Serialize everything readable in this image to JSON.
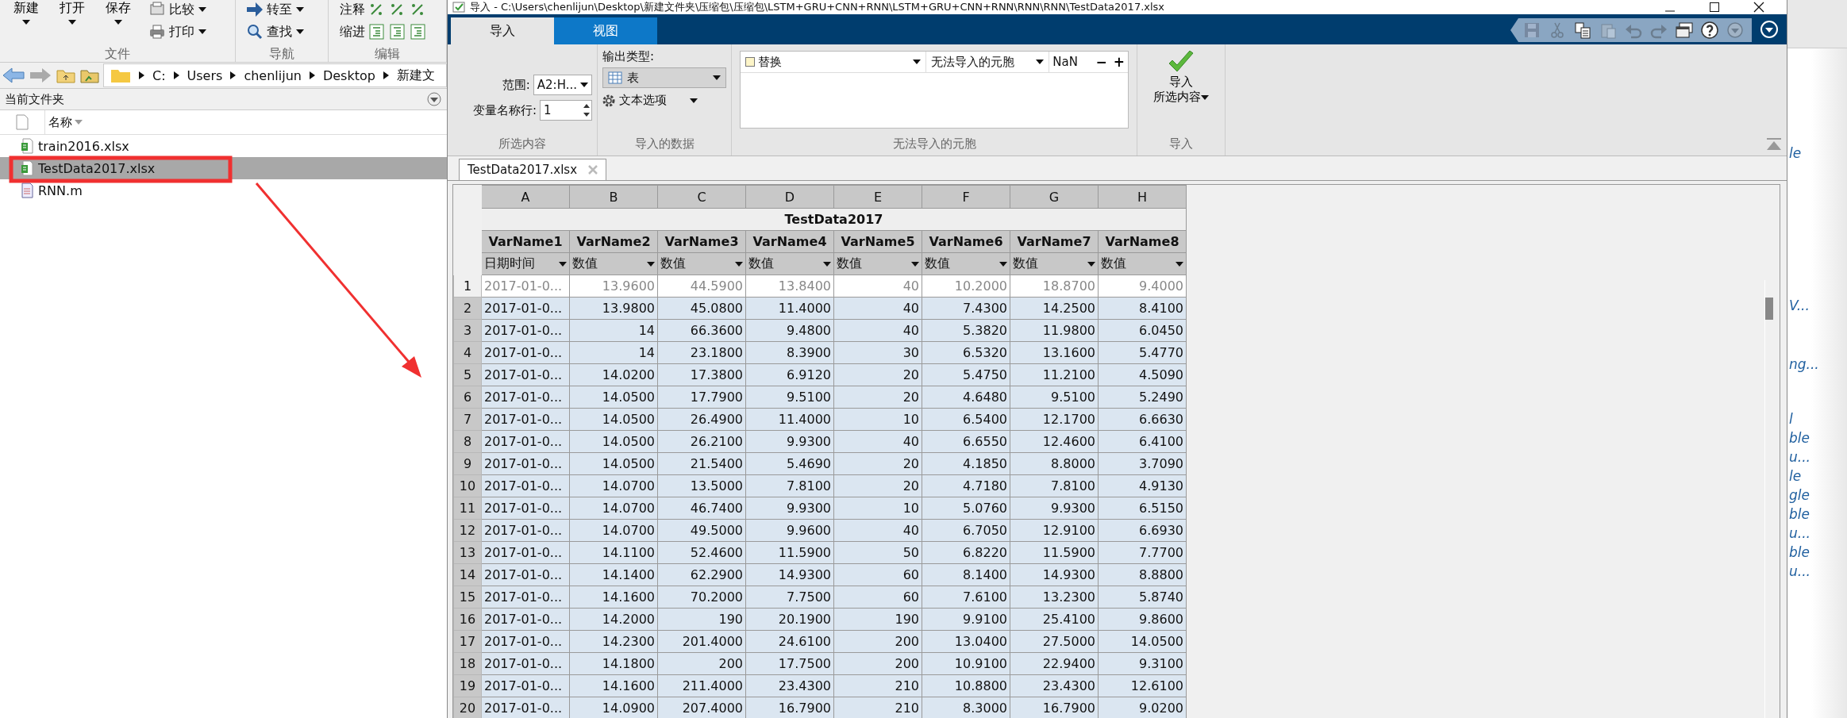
{
  "main_toolstrip": {
    "sections": [
      {
        "label": "文件",
        "big_buttons": [
          "新建",
          "打开",
          "保存"
        ],
        "small_buttons": [
          {
            "label": "比较",
            "kind": "compare"
          },
          {
            "label": "打印",
            "kind": "print"
          }
        ]
      },
      {
        "label": "导航",
        "small_buttons": [
          {
            "label": "转至",
            "kind": "goto"
          },
          {
            "label": "查找",
            "kind": "find"
          }
        ]
      },
      {
        "label": "编辑",
        "small_buttons": [
          {
            "label": "注释",
            "kind": "comment"
          },
          {
            "label": "缩进",
            "kind": "indent"
          }
        ]
      }
    ]
  },
  "address_bar": {
    "segments": [
      "C:",
      "Users",
      "chenlijun",
      "Desktop",
      "新建文"
    ]
  },
  "current_folder": {
    "title": "当前文件夹",
    "column": "名称",
    "files": [
      {
        "name": "train2016.xlsx",
        "kind": "xlsx",
        "selected": false
      },
      {
        "name": "TestData2017.xlsx",
        "kind": "xlsx",
        "selected": true
      },
      {
        "name": "RNN.m",
        "kind": "m",
        "selected": false
      }
    ]
  },
  "import_window": {
    "title": "导入 - C:\\Users\\chenlijun\\Desktop\\新建文件夹\\压缩包\\压缩包\\LSTM+GRU+CNN+RNN\\LSTM+GRU+CNN+RNN\\RNN\\RNN\\TestData2017.xlsx",
    "tabs": [
      {
        "label": "导入",
        "selected": true
      },
      {
        "label": "视图",
        "selected": false
      }
    ],
    "quick_access": [
      {
        "kind": "save",
        "disabled": true
      },
      {
        "kind": "cut",
        "disabled": true
      },
      {
        "kind": "copy",
        "disabled": false
      },
      {
        "kind": "paste",
        "disabled": true
      },
      {
        "kind": "undo",
        "disabled": true
      },
      {
        "kind": "redo",
        "disabled": true
      },
      {
        "kind": "windows",
        "disabled": false
      },
      {
        "kind": "help",
        "disabled": false
      },
      {
        "kind": "menu",
        "disabled": true
      }
    ],
    "selection": {
      "label": "所选内容",
      "range_label": "范围:",
      "range": "A2:H...",
      "names_row_label": "变量名称行:",
      "names_row": "1"
    },
    "imported_data": {
      "label": "导入的数据",
      "output_type_label": "输出类型:",
      "output_type": "表",
      "text_options": "文本选项"
    },
    "unimportable": {
      "label": "无法导入的元胞",
      "rules": [
        {
          "action": "替换",
          "target": "无法导入的元胞",
          "value": "NaN"
        }
      ],
      "buttons": [
        "−",
        "+"
      ]
    },
    "import": {
      "label": "导入",
      "button_lines": [
        "导入",
        "所选内容"
      ]
    },
    "document_tab": "TestData2017.xlsx",
    "table": {
      "title": "TestData2017",
      "columns": [
        {
          "letter": "A",
          "name": "VarName1",
          "type": "日期时间"
        },
        {
          "letter": "B",
          "name": "VarName2",
          "type": "数值"
        },
        {
          "letter": "C",
          "name": "VarName3",
          "type": "数值"
        },
        {
          "letter": "D",
          "name": "VarName4",
          "type": "数值"
        },
        {
          "letter": "E",
          "name": "VarName5",
          "type": "数值"
        },
        {
          "letter": "F",
          "name": "VarName6",
          "type": "数值"
        },
        {
          "letter": "G",
          "name": "VarName7",
          "type": "数值"
        },
        {
          "letter": "H",
          "name": "VarName8",
          "type": "数值"
        }
      ],
      "rows": [
        {
          "number": "1",
          "selected": false,
          "cells": [
            "2017-01-0...",
            "13.9600",
            "44.5900",
            "13.8400",
            "40",
            "10.2000",
            "18.8700",
            "9.4000"
          ]
        },
        {
          "number": "2",
          "selected": true,
          "cells": [
            "2017-01-0...",
            "13.9800",
            "45.0800",
            "11.4000",
            "40",
            "7.4300",
            "14.2500",
            "8.4100"
          ]
        },
        {
          "number": "3",
          "selected": true,
          "cells": [
            "2017-01-0...",
            "14",
            "66.3600",
            "9.4800",
            "40",
            "5.3820",
            "11.9800",
            "6.0450"
          ]
        },
        {
          "number": "4",
          "selected": true,
          "cells": [
            "2017-01-0...",
            "14",
            "23.1800",
            "8.3900",
            "30",
            "6.5320",
            "13.1600",
            "5.4770"
          ]
        },
        {
          "number": "5",
          "selected": true,
          "cells": [
            "2017-01-0...",
            "14.0200",
            "17.3800",
            "6.9120",
            "20",
            "5.4750",
            "11.2100",
            "4.5090"
          ]
        },
        {
          "number": "6",
          "selected": true,
          "cells": [
            "2017-01-0...",
            "14.0500",
            "17.7900",
            "9.5100",
            "20",
            "4.6480",
            "9.5100",
            "5.2490"
          ]
        },
        {
          "number": "7",
          "selected": true,
          "cells": [
            "2017-01-0...",
            "14.0500",
            "26.4900",
            "11.4000",
            "10",
            "6.5400",
            "12.1700",
            "6.6630"
          ]
        },
        {
          "number": "8",
          "selected": true,
          "cells": [
            "2017-01-0...",
            "14.0500",
            "26.2100",
            "9.9300",
            "40",
            "6.6550",
            "12.4600",
            "6.4100"
          ]
        },
        {
          "number": "9",
          "selected": true,
          "cells": [
            "2017-01-0...",
            "14.0500",
            "21.5400",
            "5.4690",
            "20",
            "4.1850",
            "8.8000",
            "3.7090"
          ]
        },
        {
          "number": "10",
          "selected": true,
          "cells": [
            "2017-01-0...",
            "14.0700",
            "13.5000",
            "7.8100",
            "20",
            "4.7180",
            "7.8100",
            "4.9130"
          ]
        },
        {
          "number": "11",
          "selected": true,
          "cells": [
            "2017-01-0...",
            "14.0700",
            "46.7400",
            "9.9300",
            "10",
            "5.0760",
            "9.9300",
            "6.5150"
          ]
        },
        {
          "number": "12",
          "selected": true,
          "cells": [
            "2017-01-0...",
            "14.0700",
            "49.5000",
            "9.9600",
            "40",
            "6.7050",
            "12.9100",
            "6.6930"
          ]
        },
        {
          "number": "13",
          "selected": true,
          "cells": [
            "2017-01-0...",
            "14.1100",
            "52.4600",
            "11.5900",
            "50",
            "6.8220",
            "11.5900",
            "7.7700"
          ]
        },
        {
          "number": "14",
          "selected": true,
          "cells": [
            "2017-01-0...",
            "14.1400",
            "62.2900",
            "14.9300",
            "60",
            "8.1400",
            "14.9300",
            "8.8800"
          ]
        },
        {
          "number": "15",
          "selected": true,
          "cells": [
            "2017-01-0...",
            "14.1600",
            "70.2000",
            "7.7500",
            "60",
            "7.6100",
            "13.2300",
            "5.8740"
          ]
        },
        {
          "number": "16",
          "selected": true,
          "cells": [
            "2017-01-0...",
            "14.2000",
            "190",
            "20.1900",
            "190",
            "9.9100",
            "25.4100",
            "9.8600"
          ]
        },
        {
          "number": "17",
          "selected": true,
          "cells": [
            "2017-01-0...",
            "14.2300",
            "201.4000",
            "24.6100",
            "200",
            "13.0400",
            "27.5000",
            "14.0500"
          ]
        },
        {
          "number": "18",
          "selected": true,
          "cells": [
            "2017-01-0...",
            "14.1800",
            "200",
            "17.7500",
            "200",
            "10.9100",
            "22.9400",
            "9.3100"
          ]
        },
        {
          "number": "19",
          "selected": true,
          "cells": [
            "2017-01-0...",
            "14.1600",
            "211.4000",
            "23.4300",
            "210",
            "10.8800",
            "23.4300",
            "12.6100"
          ]
        },
        {
          "number": "20",
          "selected": true,
          "cells": [
            "2017-01-0...",
            "14.0900",
            "207.4000",
            "16.7900",
            "210",
            "8.3000",
            "16.7900",
            "9.0200"
          ]
        }
      ]
    }
  },
  "workspace_fragments": [
    "le",
    "V...",
    "ng...",
    "l",
    "ble",
    "u...",
    "le",
    "gle",
    "ble",
    "u...",
    "ble",
    "u..."
  ]
}
